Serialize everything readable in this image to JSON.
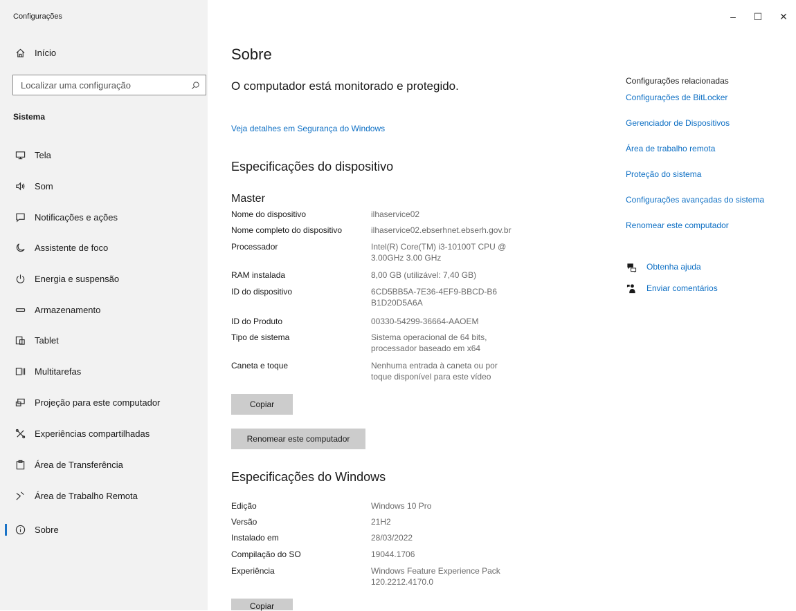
{
  "window": {
    "app_title": "Configurações",
    "minimize": "–",
    "maximize": "☐",
    "close": "✕"
  },
  "sidebar": {
    "home_label": "Início",
    "search_placeholder": "Localizar uma configuração",
    "section_label": "Sistema",
    "items": [
      {
        "label": "Tela",
        "icon": "display-icon"
      },
      {
        "label": "Som",
        "icon": "speaker-icon"
      },
      {
        "label": "Notificações e ações",
        "icon": "notification-icon"
      },
      {
        "label": "Assistente de foco",
        "icon": "moon-icon"
      },
      {
        "label": "Energia e suspensão",
        "icon": "power-icon"
      },
      {
        "label": "Armazenamento",
        "icon": "storage-icon"
      },
      {
        "label": "Tablet",
        "icon": "tablet-icon"
      },
      {
        "label": "Multitarefas",
        "icon": "multitask-icon"
      },
      {
        "label": "Projeção para este computador",
        "icon": "projection-icon"
      },
      {
        "label": "Experiências compartilhadas",
        "icon": "shared-icon"
      },
      {
        "label": "Área de Transferência",
        "icon": "clipboard-icon"
      },
      {
        "label": "Área de Trabalho Remota",
        "icon": "remote-icon"
      },
      {
        "label": "Sobre",
        "icon": "info-icon",
        "selected": true
      }
    ],
    "accent_color": "#1a73c7"
  },
  "main": {
    "title": "Sobre",
    "monitor_status": "O computador está monitorado e protegido.",
    "security_link": "Veja detalhes em Segurança do Windows",
    "device_section_title": "Especificações do dispositivo",
    "device_name_heading": "Master",
    "device_specs": [
      {
        "key": "Nome do dispositivo",
        "value": "ilhaservice02"
      },
      {
        "key": "Nome completo do dispositivo",
        "value": "ilhaservice02.ebserhnet.ebserh.gov.br"
      },
      {
        "key": "Processador",
        "value": "Intel(R) Core(TM) i3-10100T CPU @ 3.00GHz   3.00 GHz"
      },
      {
        "key": "RAM instalada",
        "value": "8,00 GB (utilizável: 7,40 GB)"
      },
      {
        "key": "ID do dispositivo",
        "value": "6CD5BB5A-7E36-4EF9-BBCD-B6B1D20D5A6A"
      },
      {
        "key": "ID do Produto",
        "value": "00330-54299-36664-AAOEM"
      },
      {
        "key": "Tipo de sistema",
        "value": "Sistema operacional de 64 bits, processador baseado em x64"
      },
      {
        "key": "Caneta e toque",
        "value": "Nenhuma entrada à caneta ou por toque disponível para este vídeo"
      }
    ],
    "copy_label": "Copiar",
    "rename_label": "Renomear este computador",
    "windows_section_title": "Especificações do Windows",
    "windows_specs": [
      {
        "key": "Edição",
        "value": "Windows 10 Pro"
      },
      {
        "key": "Versão",
        "value": "21H2"
      },
      {
        "key": "Instalado em",
        "value": "28/03/2022"
      },
      {
        "key": "Compilação do SO",
        "value": "19044.1706"
      },
      {
        "key": "Experiência",
        "value": "Windows Feature Experience Pack 120.2212.4170.0"
      }
    ],
    "copy2_label": "Copiar"
  },
  "related": {
    "title": "Configurações relacionadas",
    "links": [
      "Configurações de BitLocker",
      "Gerenciador de Dispositivos",
      "Área de trabalho remota",
      "Proteção do sistema",
      "Configurações avançadas do sistema",
      "Renomear este computador"
    ],
    "help_label": "Obtenha ajuda",
    "feedback_label": "Enviar comentários",
    "link_color": "#0d6fc4"
  }
}
